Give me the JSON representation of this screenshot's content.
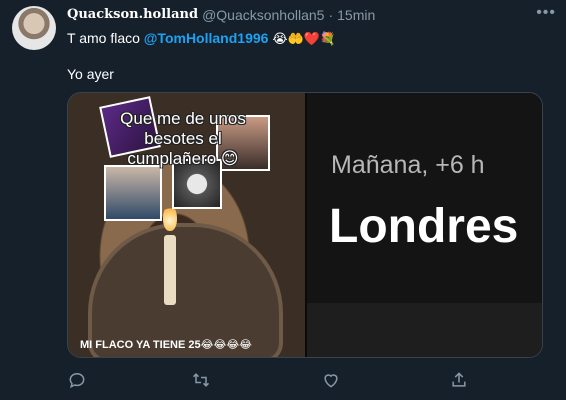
{
  "tweet": {
    "display_name": "Quackson.holland",
    "handle": "@Quacksonhollan5",
    "separator": "·",
    "time": "15min",
    "more_icon": "more-horizontal-icon",
    "text_prefix": "T amo flaco",
    "mention": "@TomHolland1996",
    "emojis": "😭🤲❤️💐",
    "text_line2": "Yo ayer"
  },
  "media": {
    "left": {
      "meme_text": "Que me de unos besotes el cumplañero 😊",
      "caption": "MI FLACO YA TIENE 25😂😂😂😂"
    },
    "right": {
      "line1": "Mañana, +6 h",
      "line2": "Londres"
    }
  },
  "actions": {
    "reply_icon": "reply-icon",
    "retweet_icon": "retweet-icon",
    "like_icon": "heart-icon",
    "share_icon": "share-icon"
  },
  "colors": {
    "background": "#15202b",
    "mention": "#1da1f2",
    "muted": "#8899a6"
  }
}
